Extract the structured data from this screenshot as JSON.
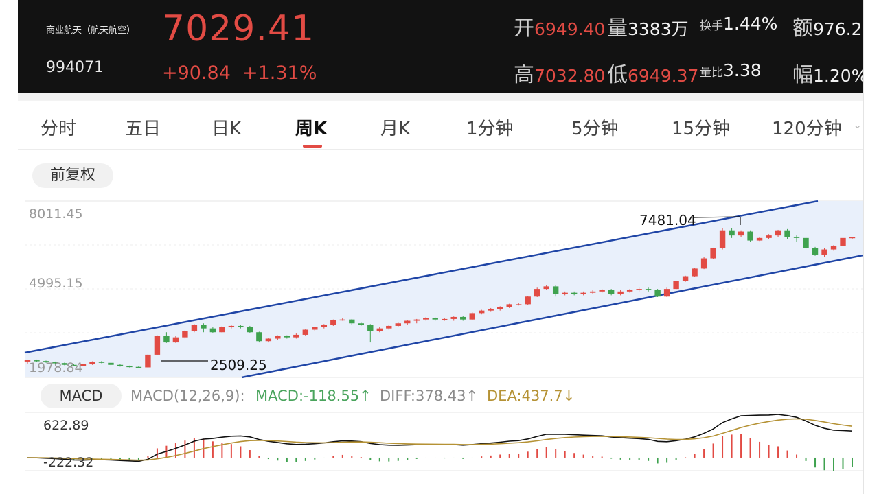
{
  "header": {
    "name": "商业航天（航天航空）",
    "code": "994071",
    "price": "7029.41",
    "change": "+90.84",
    "change_pct": "+1.31%",
    "open_label": "开",
    "open": "6949.40",
    "volume_label": "量",
    "volume": "3383万",
    "turnover_label": "换手",
    "turnover": "1.44%",
    "amount_label": "额",
    "amount": "976.2",
    "high_label": "高",
    "high": "7032.80",
    "low_label": "低",
    "low": "6949.37",
    "vol_ratio_label": "量比",
    "vol_ratio": "3.38",
    "amp_label": "幅",
    "amp": "1.20%"
  },
  "tabs": [
    "分时",
    "五日",
    "日K",
    "周K",
    "月K",
    "1分钟",
    "5分钟",
    "15分钟",
    "120分钟"
  ],
  "active_tab": "周K",
  "adjust_label": "前复权",
  "kline": {
    "y_labels": [
      "8011.45",
      "4995.15",
      "1978.84"
    ],
    "max_annotation": "7481.04",
    "min_annotation": "2509.25",
    "candles": [
      [
        2250,
        2310,
        2170,
        2320
      ],
      [
        2300,
        2270,
        2250,
        2330
      ],
      [
        2270,
        2220,
        2200,
        2290
      ],
      [
        2220,
        2190,
        2160,
        2250
      ],
      [
        2190,
        2120,
        2100,
        2210
      ],
      [
        2120,
        2080,
        2060,
        2140
      ],
      [
        2080,
        2140,
        2060,
        2160
      ],
      [
        2140,
        2240,
        2120,
        2260
      ],
      [
        2240,
        2200,
        2180,
        2270
      ],
      [
        2200,
        2120,
        2100,
        2210
      ],
      [
        2120,
        2070,
        2050,
        2140
      ],
      [
        2070,
        2040,
        2020,
        2090
      ],
      [
        2040,
        2020,
        1990,
        2060
      ],
      [
        2020,
        2520,
        2010,
        2540
      ],
      [
        2520,
        3250,
        2500,
        3280
      ],
      [
        3250,
        3000,
        2980,
        3400
      ],
      [
        3000,
        3200,
        2980,
        3250
      ],
      [
        3200,
        3450,
        3150,
        3480
      ],
      [
        3450,
        3700,
        3400,
        3720
      ],
      [
        3700,
        3550,
        3400,
        3750
      ],
      [
        3550,
        3400,
        3380,
        3600
      ],
      [
        3400,
        3600,
        3380,
        3650
      ],
      [
        3600,
        3650,
        3550,
        3700
      ],
      [
        3650,
        3600,
        3550,
        3700
      ],
      [
        3600,
        3400,
        3380,
        3650
      ],
      [
        3400,
        3050,
        3000,
        3420
      ],
      [
        3050,
        3150,
        3000,
        3180
      ],
      [
        3150,
        3250,
        3100,
        3280
      ],
      [
        3250,
        3200,
        3150,
        3280
      ],
      [
        3200,
        3300,
        3150,
        3350
      ],
      [
        3300,
        3500,
        3250,
        3520
      ],
      [
        3500,
        3600,
        3450,
        3620
      ],
      [
        3600,
        3700,
        3550,
        3720
      ],
      [
        3700,
        3880,
        3650,
        3900
      ],
      [
        3880,
        3900,
        3850,
        3950
      ],
      [
        3900,
        3750,
        3700,
        3920
      ],
      [
        3750,
        3700,
        3650,
        3780
      ],
      [
        3700,
        3450,
        3000,
        3720
      ],
      [
        3450,
        3550,
        3400,
        3600
      ],
      [
        3550,
        3650,
        3500,
        3700
      ],
      [
        3650,
        3750,
        3600,
        3780
      ],
      [
        3750,
        3850,
        3700,
        3880
      ],
      [
        3850,
        3900,
        3750,
        3920
      ],
      [
        3900,
        3950,
        3850,
        4000
      ],
      [
        3950,
        3900,
        3850,
        3980
      ],
      [
        3900,
        3920,
        3850,
        3950
      ],
      [
        3920,
        4000,
        3850,
        4020
      ],
      [
        4000,
        3900,
        3850,
        4050
      ],
      [
        3900,
        4150,
        3880,
        4180
      ],
      [
        4150,
        4250,
        4100,
        4280
      ],
      [
        4250,
        4300,
        4200,
        4350
      ],
      [
        4300,
        4400,
        4250,
        4420
      ],
      [
        4400,
        4500,
        4350,
        4520
      ],
      [
        4500,
        4500,
        4450,
        4550
      ],
      [
        4500,
        4800,
        4480,
        4820
      ],
      [
        4800,
        5100,
        4780,
        5150
      ],
      [
        5100,
        5200,
        5050,
        5250
      ],
      [
        5200,
        4900,
        4800,
        5250
      ],
      [
        4900,
        4950,
        4850,
        5000
      ],
      [
        4950,
        4900,
        4850,
        5000
      ],
      [
        4900,
        4950,
        4850,
        5000
      ],
      [
        4950,
        5000,
        4900,
        5050
      ],
      [
        5000,
        5050,
        4950,
        5100
      ],
      [
        5050,
        4900,
        4850,
        5100
      ],
      [
        4900,
        5000,
        4850,
        5050
      ],
      [
        5000,
        5050,
        4950,
        5100
      ],
      [
        5050,
        5100,
        5000,
        5150
      ],
      [
        5100,
        5050,
        5000,
        5150
      ],
      [
        5050,
        4800,
        4780,
        5100
      ],
      [
        4800,
        5100,
        4780,
        5150
      ],
      [
        5100,
        5400,
        5080,
        5420
      ],
      [
        5400,
        5600,
        5380,
        5620
      ],
      [
        5600,
        5900,
        5580,
        5920
      ],
      [
        5900,
        6300,
        5880,
        6350
      ],
      [
        6300,
        6700,
        6280,
        6720
      ],
      [
        6700,
        7400,
        6650,
        7480
      ],
      [
        7400,
        7200,
        7100,
        7481
      ],
      [
        7200,
        7350,
        7150,
        7400
      ],
      [
        7350,
        7000,
        6950,
        7400
      ],
      [
        7000,
        7100,
        6980,
        7150
      ],
      [
        7100,
        7200,
        7050,
        7250
      ],
      [
        7200,
        7400,
        7150,
        7420
      ],
      [
        7400,
        7150,
        7050,
        7450
      ],
      [
        7150,
        7100,
        6950,
        7200
      ],
      [
        7100,
        6700,
        6650,
        7150
      ],
      [
        6700,
        6450,
        6400,
        6750
      ],
      [
        6450,
        6650,
        6350,
        6700
      ],
      [
        6650,
        6800,
        6600,
        6820
      ],
      [
        6800,
        7100,
        6780,
        7120
      ],
      [
        7100,
        7130,
        7050,
        7140
      ]
    ]
  },
  "macd": {
    "button_label": "MACD",
    "params": "MACD(12,26,9):",
    "macd_text": "MACD:-118.55↑",
    "diff_text": "DIFF:378.43↑",
    "dea_text": "DEA:437.7↓",
    "y_top": "622.89",
    "y_bottom": "-222.32"
  },
  "colors": {
    "up": "#e24b44",
    "down": "#3fa24f",
    "channel": "#1f45a6",
    "channel_fill": "#e9f0fb",
    "diff_line": "#111111",
    "dea_line": "#b59235"
  }
}
